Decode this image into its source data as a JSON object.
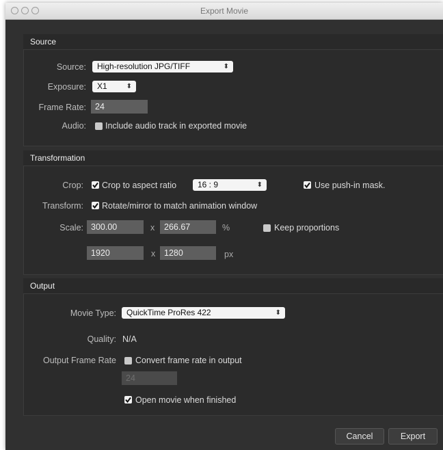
{
  "window": {
    "title": "Export Movie"
  },
  "source": {
    "header": "Source",
    "source_label": "Source:",
    "source_value": "High-resolution JPG/TIFF",
    "exposure_label": "Exposure:",
    "exposure_value": "X1",
    "frame_rate_label": "Frame Rate:",
    "frame_rate_value": "24",
    "audio_label": "Audio:",
    "audio_checkbox_label": "Include audio track in exported movie",
    "audio_checked": false
  },
  "transformation": {
    "header": "Transformation",
    "crop_label": "Crop:",
    "crop_checkbox_label": "Crop to aspect ratio",
    "crop_checked": true,
    "aspect_ratio_value": "16 : 9",
    "push_in_label": "Use push-in mask.",
    "push_in_checked": true,
    "transform_label": "Transform:",
    "rotate_label": "Rotate/mirror to match animation window",
    "rotate_checked": true,
    "scale_label": "Scale:",
    "scale_x": "300.00",
    "scale_y": "266.67",
    "times": "x",
    "percent_unit": "%",
    "keep_proportions_label": "Keep proportions",
    "keep_proportions_checked": false,
    "px_width": "1920",
    "px_height": "1280",
    "px_unit": "px"
  },
  "output": {
    "header": "Output",
    "movie_type_label": "Movie Type:",
    "movie_type_value": "QuickTime ProRes 422",
    "quality_label": "Quality:",
    "quality_value": "N/A",
    "output_frame_rate_label": "Output Frame Rate",
    "convert_label": "Convert frame rate in output",
    "convert_checked": false,
    "converted_rate_value": "24",
    "open_when_finished_label": "Open movie when finished",
    "open_when_finished_checked": true
  },
  "buttons": {
    "cancel": "Cancel",
    "export": "Export"
  }
}
